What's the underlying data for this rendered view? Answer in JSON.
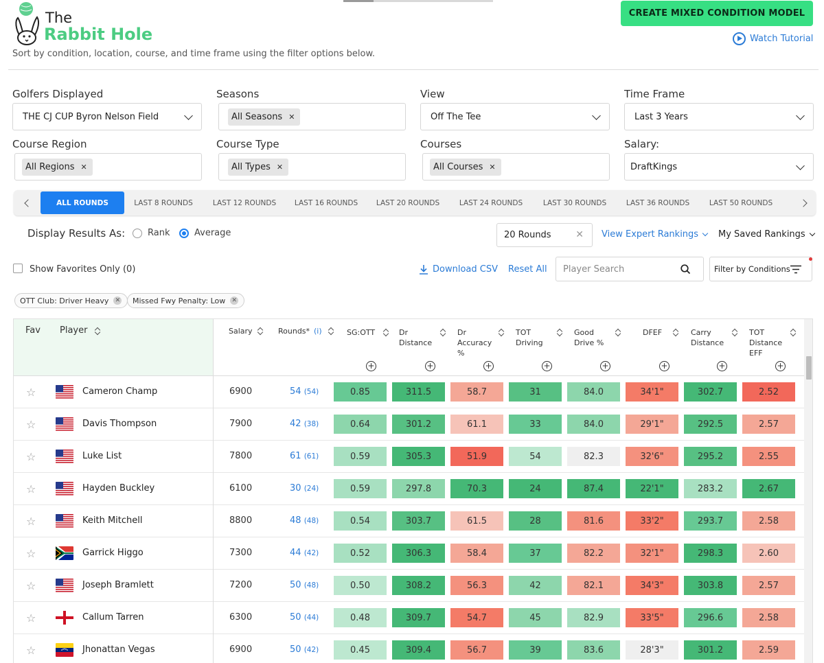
{
  "brand": {
    "line1": "The",
    "line2": "Rabbit Hole"
  },
  "subtitle": "Sort by condition, location, course, and time frame using the filter options below.",
  "create_button": "CREATE MIXED CONDITION MODEL",
  "tutorial_label": "Watch Tutorial",
  "filters": {
    "golfers": {
      "label": "Golfers Displayed",
      "value": "THE CJ CUP Byron Nelson Field"
    },
    "seasons": {
      "label": "Seasons",
      "chip": "All Seasons"
    },
    "view": {
      "label": "View",
      "value": "Off The Tee"
    },
    "time_frame": {
      "label": "Time Frame",
      "value": "Last 3 Years"
    },
    "course_region": {
      "label": "Course Region",
      "chip": "All Regions"
    },
    "course_type": {
      "label": "Course Type",
      "chip": "All Types"
    },
    "courses": {
      "label": "Courses",
      "chip": "All Courses"
    },
    "salary": {
      "label": "Salary:",
      "value": "DraftKings"
    }
  },
  "round_tabs": [
    "ALL ROUNDS",
    "LAST 8 ROUNDS",
    "LAST 12 ROUNDS",
    "LAST 16 ROUNDS",
    "LAST 20 ROUNDS",
    "LAST 24 ROUNDS",
    "LAST 30 ROUNDS",
    "LAST 36 ROUNDS",
    "LAST 50 ROUNDS"
  ],
  "active_round_tab": "ALL ROUNDS",
  "display": {
    "label": "Display Results As:",
    "option_rank": "Rank",
    "option_average": "Average",
    "selected": "Average"
  },
  "rounds_input": "20 Rounds",
  "expert_rankings": "View Expert Rankings",
  "saved_rankings": "My Saved Rankings",
  "favorites_label": "Show Favorites Only (0)",
  "download_csv": "Download CSV",
  "reset_all": "Reset All",
  "search_placeholder": "Player Search",
  "filter_conditions": "Filter by Conditions",
  "condition_chips": [
    "OTT Club: Driver Heavy",
    "Missed Fwy Penalty: Low"
  ],
  "table": {
    "headers": {
      "fav": "Fav",
      "player": "Player",
      "salary": "Salary",
      "rounds": "Rounds",
      "rounds_star": "*",
      "rounds_info": "(i)",
      "sg_ott": "SG:OTT",
      "dr_distance": [
        "Dr",
        "Distance"
      ],
      "dr_accuracy": [
        "Dr",
        "Accuracy",
        "%"
      ],
      "tot_driving": [
        "TOT",
        "Driving"
      ],
      "good_drive": [
        "Good",
        "Drive %"
      ],
      "dfef": "DFEF",
      "carry_distance": [
        "Carry",
        "Distance"
      ],
      "tot_distance_eff": [
        "TOT",
        "Distance",
        "EFF"
      ]
    },
    "rows": [
      {
        "name": "Cameron Champ",
        "flag": "usa",
        "salary": "6900",
        "rounds": "54",
        "rounds_sub": "(54)",
        "sg": "0.85",
        "dd": "311.5",
        "da": "58.7",
        "td": "31",
        "gd": "84.0",
        "dfef": "34'1\"",
        "cd": "302.7",
        "tde": "2.52"
      },
      {
        "name": "Davis Thompson",
        "flag": "usa",
        "salary": "7900",
        "rounds": "42",
        "rounds_sub": "(38)",
        "sg": "0.64",
        "dd": "301.2",
        "da": "61.1",
        "td": "33",
        "gd": "84.0",
        "dfef": "29'1\"",
        "cd": "292.5",
        "tde": "2.57"
      },
      {
        "name": "Luke List",
        "flag": "usa",
        "salary": "7800",
        "rounds": "61",
        "rounds_sub": "(61)",
        "sg": "0.59",
        "dd": "305.3",
        "da": "51.9",
        "td": "54",
        "gd": "82.3",
        "dfef": "32'6\"",
        "cd": "295.2",
        "tde": "2.55"
      },
      {
        "name": "Hayden Buckley",
        "flag": "usa",
        "salary": "6100",
        "rounds": "30",
        "rounds_sub": "(24)",
        "sg": "0.59",
        "dd": "297.8",
        "da": "70.3",
        "td": "24",
        "gd": "87.4",
        "dfef": "22'1\"",
        "cd": "283.2",
        "tde": "2.67"
      },
      {
        "name": "Keith Mitchell",
        "flag": "usa",
        "salary": "8800",
        "rounds": "48",
        "rounds_sub": "(48)",
        "sg": "0.54",
        "dd": "303.7",
        "da": "61.5",
        "td": "28",
        "gd": "81.6",
        "dfef": "33'2\"",
        "cd": "293.7",
        "tde": "2.58"
      },
      {
        "name": "Garrick Higgo",
        "flag": "rsa",
        "salary": "7300",
        "rounds": "44",
        "rounds_sub": "(42)",
        "sg": "0.52",
        "dd": "306.3",
        "da": "58.4",
        "td": "37",
        "gd": "82.2",
        "dfef": "32'1\"",
        "cd": "298.3",
        "tde": "2.60"
      },
      {
        "name": "Joseph Bramlett",
        "flag": "usa",
        "salary": "7200",
        "rounds": "50",
        "rounds_sub": "(48)",
        "sg": "0.50",
        "dd": "308.2",
        "da": "56.3",
        "td": "42",
        "gd": "82.1",
        "dfef": "34'3\"",
        "cd": "303.8",
        "tde": "2.57"
      },
      {
        "name": "Callum Tarren",
        "flag": "eng",
        "salary": "6300",
        "rounds": "50",
        "rounds_sub": "(44)",
        "sg": "0.48",
        "dd": "309.7",
        "da": "54.7",
        "td": "45",
        "gd": "82.9",
        "dfef": "33'5\"",
        "cd": "296.6",
        "tde": "2.58"
      },
      {
        "name": "Jhonattan Vegas",
        "flag": "ven",
        "salary": "6900",
        "rounds": "50",
        "rounds_sub": "(42)",
        "sg": "0.45",
        "dd": "309.4",
        "da": "56.7",
        "td": "39",
        "gd": "83.6",
        "dfef": "28'3\"",
        "cd": "301.2",
        "tde": "2.59"
      }
    ],
    "cell_colors": [
      [
        "#67c994",
        "#45b876",
        "#f4a796",
        "#57c083",
        "#8dd6ac",
        "#f47b67",
        "#45b876",
        "#f2685a"
      ],
      [
        "#8dd6ac",
        "#57c083",
        "#f6c3b8",
        "#67c994",
        "#8dd6ac",
        "#f4a796",
        "#57c083",
        "#f4a796"
      ],
      [
        "#a8e0c1",
        "#45b876",
        "#f2685a",
        "#bde8d0",
        "#efefef",
        "#f4917e",
        "#57c083",
        "#f4917e"
      ],
      [
        "#a8e0c1",
        "#8dd6ac",
        "#45b876",
        "#45b876",
        "#45b876",
        "#45b876",
        "#a8e0c1",
        "#45b876"
      ],
      [
        "#a8e0c1",
        "#57c083",
        "#f6c3b8",
        "#57c083",
        "#f4917e",
        "#f47b67",
        "#67c994",
        "#f4a796"
      ],
      [
        "#a8e0c1",
        "#45b876",
        "#f4a796",
        "#67c994",
        "#f4a796",
        "#f4917e",
        "#45b876",
        "#f6c3b8"
      ],
      [
        "#bde8d0",
        "#45b876",
        "#f4917e",
        "#8dd6ac",
        "#f4a796",
        "#f47b67",
        "#45b876",
        "#f4a796"
      ],
      [
        "#bde8d0",
        "#45b876",
        "#f47b67",
        "#8dd6ac",
        "#a8e0c1",
        "#f47b67",
        "#67c994",
        "#f4a796"
      ],
      [
        "#bde8d0",
        "#45b876",
        "#f4917e",
        "#67c994",
        "#8dd6ac",
        "#efefef",
        "#45b876",
        "#f4a796"
      ]
    ]
  },
  "colors": {
    "accent": "#37df83",
    "link": "#2b7bd6",
    "active_tab": "#1d7ff0"
  }
}
